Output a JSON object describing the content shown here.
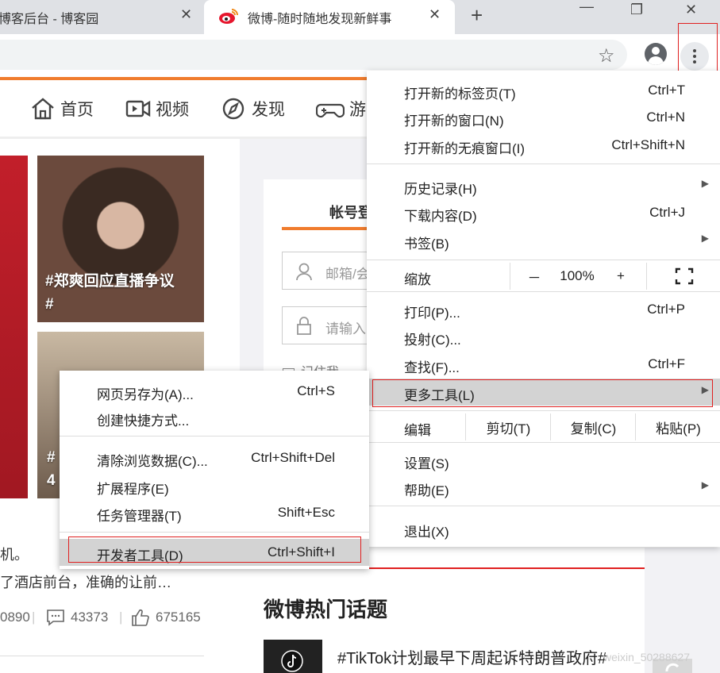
{
  "browser": {
    "tabs": [
      {
        "title": "博客后台 - 博客园",
        "active": false
      },
      {
        "title": "微博-随时随地发现新鲜事",
        "active": true
      }
    ],
    "close_glyph": "✕",
    "new_tab_glyph": "+",
    "window_controls": {
      "minimize": "—",
      "restore": "❐",
      "close": "✕"
    },
    "star_glyph": "☆"
  },
  "weibo": {
    "nav": [
      "首页",
      "视频",
      "发现",
      "游"
    ],
    "card1_caption_line1": "#郑爽回应直播争议",
    "card1_caption_line2": "#",
    "card2_caption_line1": "#",
    "card2_caption_line2": "4",
    "login": {
      "tab": "帐号登",
      "email_placeholder": "邮箱/会",
      "password_placeholder": "请输入",
      "remember": "记住我"
    },
    "post_text_1": "机。",
    "post_text_2": "了酒店前台，准确的让前…",
    "stats": {
      "reposts": "0890",
      "comments": "43373",
      "likes": "675165"
    },
    "hot_title": "微博热门话题",
    "hot_item": "#TikTok计划最早下周起诉特朗普政府#",
    "watermark": "weixin_50288627"
  },
  "menu": {
    "items": [
      {
        "label": "打开新的标签页(T)",
        "shortcut": "Ctrl+T"
      },
      {
        "label": "打开新的窗口(N)",
        "shortcut": "Ctrl+N"
      },
      {
        "label": "打开新的无痕窗口(I)",
        "shortcut": "Ctrl+Shift+N"
      },
      {
        "label": "历史记录(H)",
        "shortcut": ""
      },
      {
        "label": "下载内容(D)",
        "shortcut": "Ctrl+J"
      },
      {
        "label": "书签(B)",
        "shortcut": ""
      },
      {
        "label": "打印(P)...",
        "shortcut": "Ctrl+P"
      },
      {
        "label": "投射(C)...",
        "shortcut": ""
      },
      {
        "label": "查找(F)...",
        "shortcut": "Ctrl+F"
      },
      {
        "label": "更多工具(L)",
        "shortcut": ""
      },
      {
        "label": "设置(S)",
        "shortcut": ""
      },
      {
        "label": "帮助(E)",
        "shortcut": ""
      },
      {
        "label": "退出(X)",
        "shortcut": ""
      }
    ],
    "zoom": {
      "label": "缩放",
      "minus": "－",
      "value": "100%",
      "plus": "+"
    },
    "edit": {
      "label": "编辑",
      "cut": "剪切(T)",
      "copy": "复制(C)",
      "paste": "粘贴(P)"
    },
    "submenu_arrow": "▶"
  },
  "submenu": {
    "items": [
      {
        "label": "网页另存为(A)...",
        "shortcut": "Ctrl+S"
      },
      {
        "label": "创建快捷方式...",
        "shortcut": ""
      },
      {
        "label": "清除浏览数据(C)...",
        "shortcut": "Ctrl+Shift+Del"
      },
      {
        "label": "扩展程序(E)",
        "shortcut": ""
      },
      {
        "label": "任务管理器(T)",
        "shortcut": "Shift+Esc"
      },
      {
        "label": "开发者工具(D)",
        "shortcut": "Ctrl+Shift+I"
      }
    ]
  }
}
